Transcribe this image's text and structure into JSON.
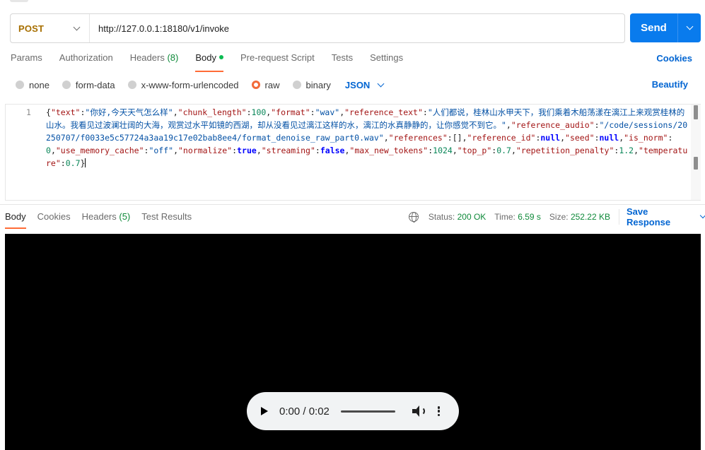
{
  "request": {
    "method": "POST",
    "url": "http://127.0.0.1:18180/v1/invoke",
    "send_label": "Send"
  },
  "request_tabs": [
    {
      "label": "Params"
    },
    {
      "label": "Authorization"
    },
    {
      "label": "Headers",
      "count": "(8)"
    },
    {
      "label": "Body"
    },
    {
      "label": "Pre-request Script"
    },
    {
      "label": "Tests"
    },
    {
      "label": "Settings"
    }
  ],
  "cookies_label": "Cookies",
  "body_types": [
    {
      "label": "none"
    },
    {
      "label": "form-data"
    },
    {
      "label": "x-www-form-urlencoded"
    },
    {
      "label": "raw"
    },
    {
      "label": "binary"
    }
  ],
  "body_format": "JSON",
  "beautify_label": "Beautify",
  "editor": {
    "line_number": "1",
    "body": [
      {
        "key": "text",
        "value": "你好,今天天气怎么样",
        "type": "string"
      },
      {
        "key": "chunk_length",
        "value": "100",
        "type": "number"
      },
      {
        "key": "format",
        "value": "wav",
        "type": "string"
      },
      {
        "key": "reference_text",
        "value": "人们都说，桂林山水甲天下，我们乘着木船荡漾在漓江上来观赏桂林的山水。我看见过波澜壮阔的大海，观赏过水平如镜的西湖，却从没看见过漓江这样的水，漓江的水真静静的，让你感觉不到它。",
        "type": "string"
      },
      {
        "key": "reference_audio",
        "value": "/code/sessions/20250707/f0033e5c57724a3aa19c17e02bab8ee4/format_denoise_raw_part0.wav",
        "type": "string"
      },
      {
        "key": "references",
        "value": "[]",
        "type": "punct"
      },
      {
        "key": "reference_id",
        "value": "null",
        "type": "keyword"
      },
      {
        "key": "seed",
        "value": "null",
        "type": "keyword"
      },
      {
        "key": "is_norm",
        "value": "0",
        "type": "number"
      },
      {
        "key": "use_memory_cache",
        "value": "off",
        "type": "string"
      },
      {
        "key": "normalize",
        "value": "true",
        "type": "keyword"
      },
      {
        "key": "streaming",
        "value": "false",
        "type": "keyword"
      },
      {
        "key": "max_new_tokens",
        "value": "1024",
        "type": "number"
      },
      {
        "key": "top_p",
        "value": "0.7",
        "type": "number"
      },
      {
        "key": "repetition_penalty",
        "value": "1.2",
        "type": "number"
      },
      {
        "key": "temperature",
        "value": "0.7",
        "type": "number"
      }
    ]
  },
  "response_tabs": [
    {
      "label": "Body"
    },
    {
      "label": "Cookies"
    },
    {
      "label": "Headers",
      "count": "(5)"
    },
    {
      "label": "Test Results"
    }
  ],
  "response_meta": {
    "status_label": "Status:",
    "status_value": "200 OK",
    "time_label": "Time:",
    "time_value": "6.59 s",
    "size_label": "Size:",
    "size_value": "252.22 KB",
    "save_label": "Save Response"
  },
  "player": {
    "time": "0:00 / 0:02",
    "progress": 0
  },
  "colors": {
    "accent": "#097bed",
    "method": "#a76f00",
    "link": "#0265d2",
    "active_tab": "#ff6c37",
    "ok": "#0f8a3a"
  }
}
